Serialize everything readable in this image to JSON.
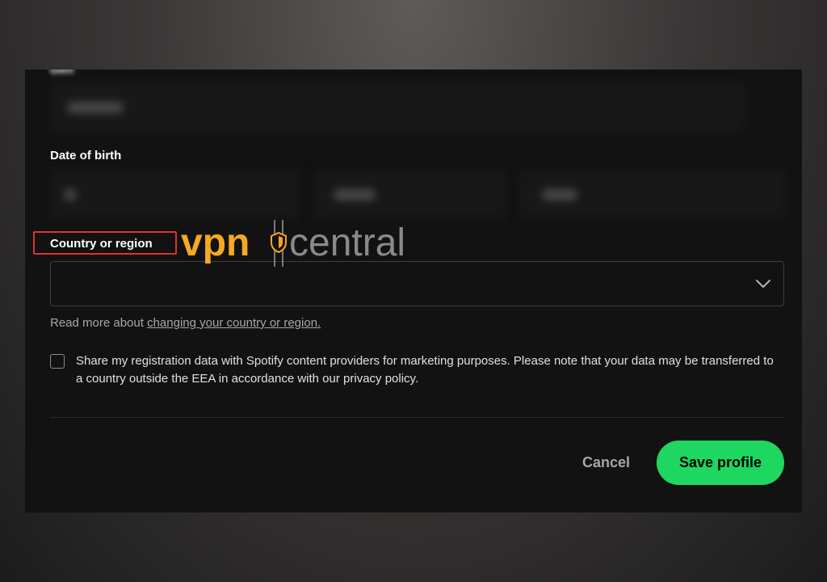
{
  "form": {
    "cut_label": "Gen",
    "dob_label": "Date of birth",
    "country_label": "Country or region",
    "country_value": "",
    "help_prefix": "Read more about ",
    "help_link": "changing your country or region.",
    "consent_text": "Share my registration data with Spotify content providers for marketing purposes. Please note that your data may be transferred to a country outside the EEA in accordance with our privacy policy.",
    "consent_checked": false,
    "cancel_label": "Cancel",
    "save_label": "Save profile"
  },
  "watermark": {
    "brand_a": "vpn",
    "brand_b": "central"
  },
  "colors": {
    "accent_green": "#1ed760",
    "highlight_red": "#e03131",
    "watermark_orange": "#f7a823",
    "panel_bg": "#121212"
  },
  "icons": {
    "select": "chevron-down-icon",
    "watermark": "shield-icon"
  }
}
